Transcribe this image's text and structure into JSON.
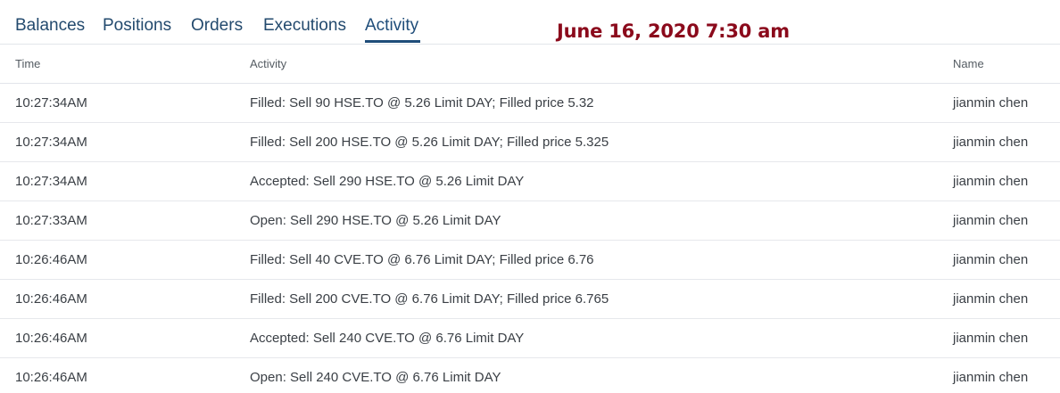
{
  "tabs": [
    {
      "label": "Balances",
      "active": false
    },
    {
      "label": "Positions",
      "active": false
    },
    {
      "label": "Orders",
      "active": false
    },
    {
      "label": "Executions",
      "active": false
    },
    {
      "label": "Activity",
      "active": true
    }
  ],
  "date_stamp": "June 16, 2020 7:30 am",
  "colors": {
    "tab_text": "#234a6e",
    "active_underline": "#1f4d7a",
    "date_stamp": "#8b0a1c"
  },
  "table": {
    "headers": {
      "time": "Time",
      "activity": "Activity",
      "name": "Name"
    },
    "rows": [
      {
        "time": "10:27:34AM",
        "activity": "Filled: Sell 90 HSE.TO @ 5.26 Limit DAY; Filled price 5.32",
        "name": "jianmin chen"
      },
      {
        "time": "10:27:34AM",
        "activity": "Filled: Sell 200 HSE.TO @ 5.26 Limit DAY; Filled price 5.325",
        "name": "jianmin chen"
      },
      {
        "time": "10:27:34AM",
        "activity": "Accepted: Sell 290 HSE.TO @ 5.26 Limit DAY",
        "name": "jianmin chen"
      },
      {
        "time": "10:27:33AM",
        "activity": "Open: Sell 290 HSE.TO @ 5.26 Limit DAY",
        "name": "jianmin chen"
      },
      {
        "time": "10:26:46AM",
        "activity": "Filled: Sell 40 CVE.TO @ 6.76 Limit DAY; Filled price 6.76",
        "name": "jianmin chen"
      },
      {
        "time": "10:26:46AM",
        "activity": "Filled: Sell 200 CVE.TO @ 6.76 Limit DAY; Filled price 6.765",
        "name": "jianmin chen"
      },
      {
        "time": "10:26:46AM",
        "activity": "Accepted: Sell 240 CVE.TO @ 6.76 Limit DAY",
        "name": "jianmin chen"
      },
      {
        "time": "10:26:46AM",
        "activity": "Open: Sell 240 CVE.TO @ 6.76 Limit DAY",
        "name": "jianmin chen"
      }
    ]
  }
}
